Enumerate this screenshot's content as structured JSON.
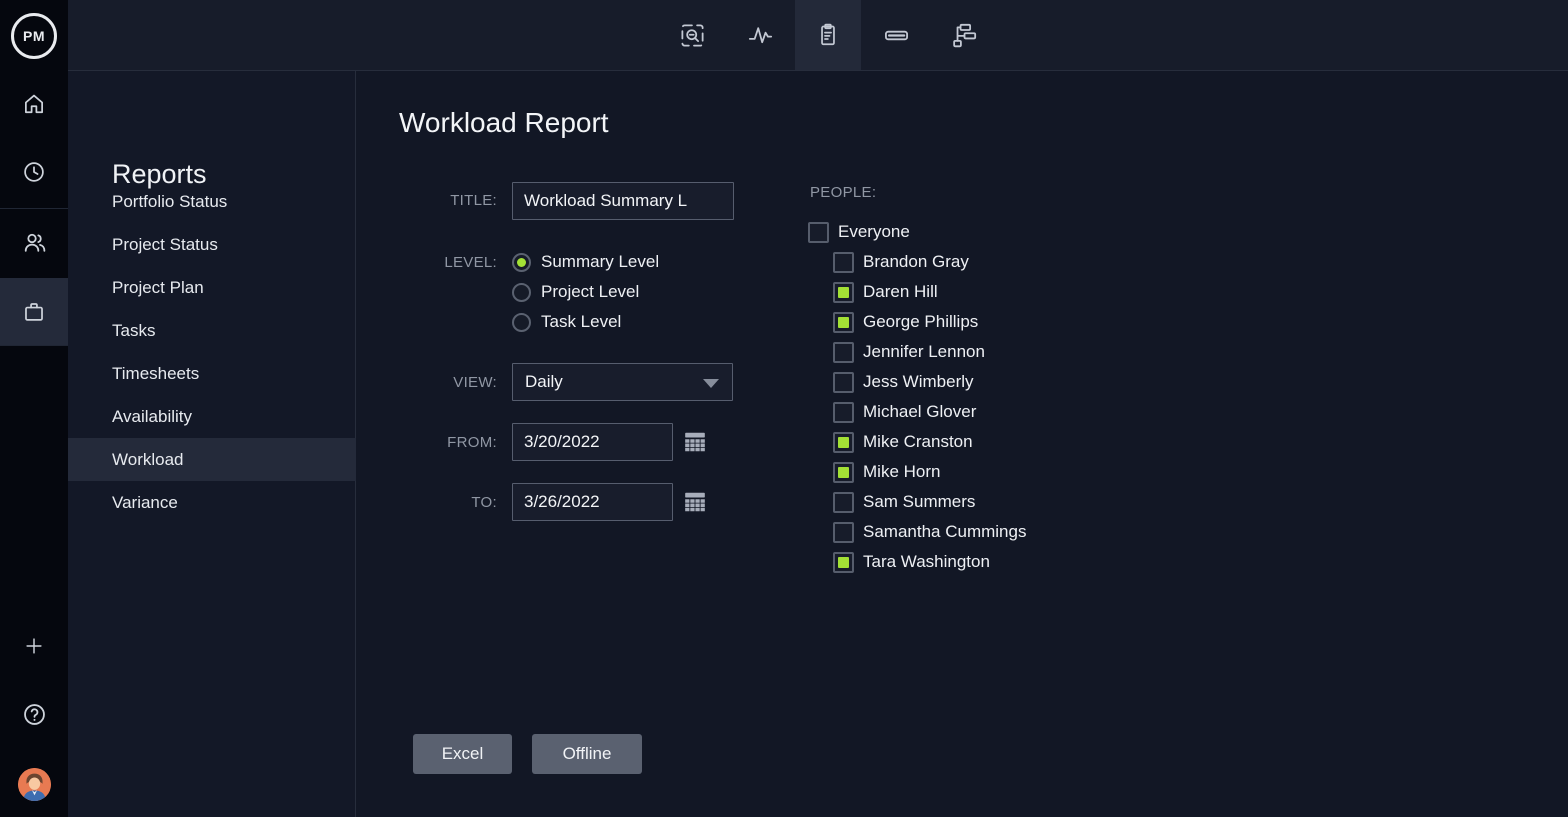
{
  "app": {
    "logo": "PM"
  },
  "topbar": {
    "tabs": [
      {
        "icon": "zoom-area-icon",
        "active": false
      },
      {
        "icon": "activity-icon",
        "active": false
      },
      {
        "icon": "report-icon",
        "active": true
      },
      {
        "icon": "card-icon",
        "active": false
      },
      {
        "icon": "workflow-icon",
        "active": false
      }
    ]
  },
  "rail": {
    "items": [
      {
        "icon": "home-icon",
        "active": false
      },
      {
        "icon": "clock-icon",
        "active": false
      },
      {
        "icon": "users-icon",
        "active": false
      },
      {
        "icon": "briefcase-icon",
        "active": true
      },
      {
        "icon": "plus-icon",
        "active": false
      },
      {
        "icon": "help-icon",
        "active": false
      },
      {
        "icon": "user-avatar",
        "active": false
      }
    ]
  },
  "sidebar": {
    "title": "Reports",
    "items": [
      {
        "label": "Portfolio Status",
        "selected": false
      },
      {
        "label": "Project Status",
        "selected": false
      },
      {
        "label": "Project Plan",
        "selected": false
      },
      {
        "label": "Tasks",
        "selected": false
      },
      {
        "label": "Timesheets",
        "selected": false
      },
      {
        "label": "Availability",
        "selected": false
      },
      {
        "label": "Workload",
        "selected": true
      },
      {
        "label": "Variance",
        "selected": false
      }
    ]
  },
  "main": {
    "title": "Workload Report",
    "form": {
      "title_label": "TITLE:",
      "title_value": "Workload Summary L",
      "level_label": "LEVEL:",
      "levels": [
        {
          "label": "Summary Level",
          "selected": true
        },
        {
          "label": "Project Level",
          "selected": false
        },
        {
          "label": "Task Level",
          "selected": false
        }
      ],
      "view_label": "VIEW:",
      "view_value": "Daily",
      "from_label": "FROM:",
      "from_value": "3/20/2022",
      "to_label": "TO:",
      "to_value": "3/26/2022"
    },
    "people": {
      "label": "PEOPLE:",
      "everyone": {
        "label": "Everyone",
        "checked": false
      },
      "members": [
        {
          "name": "Brandon Gray",
          "checked": false
        },
        {
          "name": "Daren Hill",
          "checked": true
        },
        {
          "name": "George Phillips",
          "checked": true
        },
        {
          "name": "Jennifer Lennon",
          "checked": false
        },
        {
          "name": "Jess Wimberly",
          "checked": false
        },
        {
          "name": "Michael Glover",
          "checked": false
        },
        {
          "name": "Mike Cranston",
          "checked": true
        },
        {
          "name": "Mike Horn",
          "checked": true
        },
        {
          "name": "Sam Summers",
          "checked": false
        },
        {
          "name": "Samantha Cummings",
          "checked": false
        },
        {
          "name": "Tara Washington",
          "checked": true
        }
      ]
    },
    "buttons": [
      {
        "label": "Excel"
      },
      {
        "label": "Offline"
      }
    ]
  },
  "colors": {
    "accent_lime": "#a3e135",
    "topbar_bg": "#171c2a",
    "rail_bg": "#05070e",
    "page_bg": "#121725",
    "selected_row_bg": "#242a3a",
    "input_border": "#565d6e",
    "button_gray": "#5a6170",
    "avatar_orange": "#e87a52"
  }
}
